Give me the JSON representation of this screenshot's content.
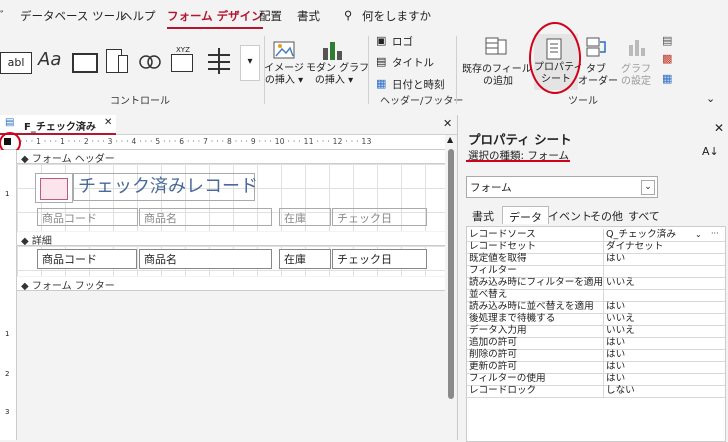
{
  "menu": {
    "items": [
      "データベース ツール",
      "ヘルプ",
      "フォーム デザイン",
      "配置",
      "書式"
    ],
    "active_index": 2,
    "search": "何をしますか"
  },
  "ribbon": {
    "controls_group": "コントロール",
    "header_footer_group": "ヘッダー/フッター",
    "tools_group": "ツール",
    "image_insert": "イメージ\nの挿入 ▾",
    "modern_chart": "モダン グラフ\nの挿入 ▾",
    "logo": "ロゴ",
    "title": "タイトル",
    "datetime": "日付と時刻",
    "add_fields": "既存のフィールド\nの追加",
    "property_sheet": "プロパティ\nシート",
    "tab_order": "タブ\nオーダー",
    "chart_settings": "グラフ\nの設定",
    "textbox_icon": "abl",
    "label_icon": "Aa",
    "xyz": "XYZ"
  },
  "document": {
    "tab_title": "F_チェック済み",
    "ruler_text": "· · · 1 · · · 1 · · · 2 · · · 3 · · · 4 · · · 5 · · · 6 · · · 7 · · · 8 · · · 9 · · · 10 · · · 11 · · · 12 · · · 13",
    "form_header_band": "◆ フォーム ヘッダー",
    "detail_band": "◆ 詳細",
    "form_footer_band": "◆ フォーム フッター",
    "title_label": "チェック済みレコード",
    "header_labels": [
      "商品コード",
      "商品名",
      "在庫",
      "チェック日"
    ],
    "detail_fields": [
      "商品コード",
      "商品名",
      "在庫",
      "チェック日"
    ]
  },
  "property_sheet": {
    "title": "プロパティ シート",
    "selection_type": "選択の種類: フォーム",
    "selected_object": "フォーム",
    "tabs": [
      "書式",
      "データ",
      "イベント",
      "その他",
      "すべて"
    ],
    "active_tab": 1,
    "rows": [
      {
        "key": "レコードソース",
        "value": "Q_チェック済み"
      },
      {
        "key": "レコードセット",
        "value": "ダイナセット"
      },
      {
        "key": "既定値を取得",
        "value": "はい"
      },
      {
        "key": "フィルター",
        "value": ""
      },
      {
        "key": "読み込み時にフィルターを適用",
        "value": "いいえ"
      },
      {
        "key": "並べ替え",
        "value": ""
      },
      {
        "key": "読み込み時に並べ替えを適用",
        "value": "はい"
      },
      {
        "key": "後処理まで待機する",
        "value": "いいえ"
      },
      {
        "key": "データ入力用",
        "value": "いいえ"
      },
      {
        "key": "追加の許可",
        "value": "はい"
      },
      {
        "key": "削除の許可",
        "value": "はい"
      },
      {
        "key": "更新の許可",
        "value": "はい"
      },
      {
        "key": "フィルターの使用",
        "value": "はい"
      },
      {
        "key": "レコードロック",
        "value": "しない"
      }
    ]
  },
  "colors": {
    "accent": "#b3162f",
    "annotation": "#d0021b"
  }
}
